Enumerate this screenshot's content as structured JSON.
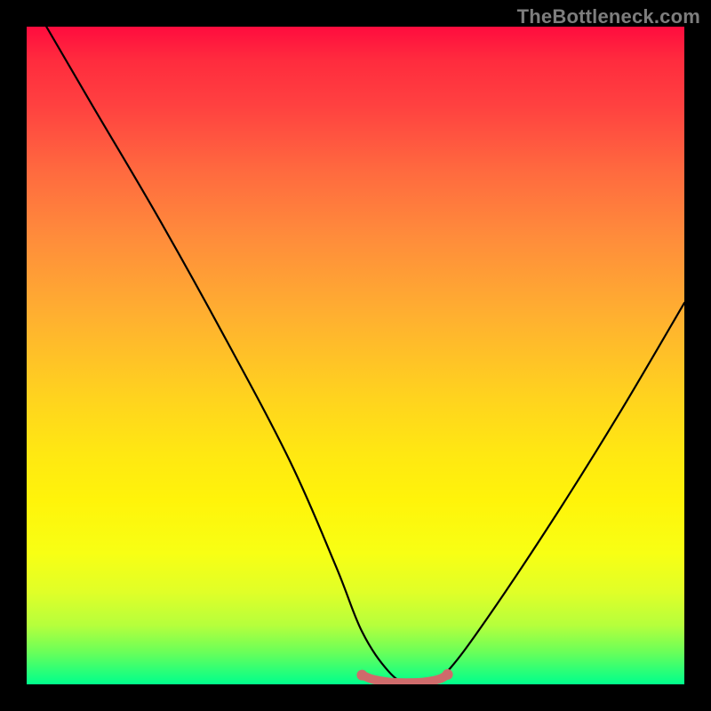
{
  "watermark": "TheBottleneck.com",
  "chart_data": {
    "type": "line",
    "title": "",
    "xlabel": "",
    "ylabel": "",
    "xlim": [
      0,
      100
    ],
    "ylim": [
      0,
      100
    ],
    "grid": false,
    "series": [
      {
        "name": "bottleneck-curve",
        "x": [
          3,
          10,
          20,
          30,
          40,
          47,
          51,
          55,
          58,
          61,
          64,
          70,
          80,
          90,
          100
        ],
        "values": [
          100,
          88,
          71,
          53,
          34,
          18,
          8,
          2,
          0,
          0,
          2,
          10,
          25,
          41,
          58
        ],
        "color": "#000000"
      },
      {
        "name": "flat-minimum-marker",
        "x": [
          51,
          52.5,
          54,
          55.5,
          57,
          58.5,
          60,
          61.5,
          63,
          64
        ],
        "values": [
          1.4,
          0.8,
          0.5,
          0.3,
          0.25,
          0.25,
          0.3,
          0.5,
          0.9,
          1.5
        ],
        "color": "#cf6b6b"
      }
    ],
    "background_gradient": {
      "top": "#ff0c3e",
      "mid": "#ffe812",
      "bottom": "#00ff8c"
    }
  }
}
